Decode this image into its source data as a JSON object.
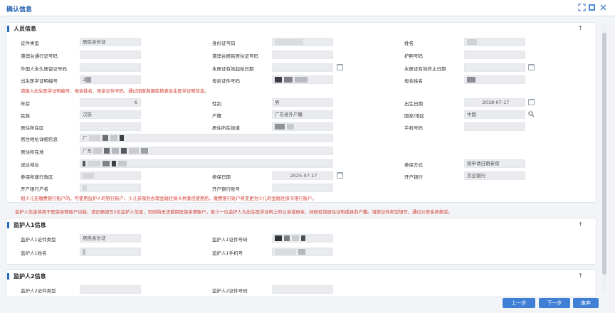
{
  "window": {
    "title": "确认信息"
  },
  "sections": {
    "person": "人员信息",
    "guardian1": "监护人1信息",
    "guardian2": "监护人2信息"
  },
  "person": {
    "id_type_label": "证件类型",
    "id_type_value": "居民身份证",
    "id_no_label": "身份证号码",
    "name_label": "姓名",
    "hk_permit_label": "港澳台通行证号码",
    "hk_residence_label": "港澳台居民居住证号码",
    "passport_label": "护照号码",
    "foreign_perm_label": "外国人永久居留证号码",
    "perm_start_label": "永居证有效起始日期",
    "perm_end_label": "永居证有效终止日期",
    "birth_cert_label": "出生医学证明编号",
    "birth_cert_value": "2",
    "mother_id_label": "母亲证件号码",
    "mother_name_label": "母亲姓名",
    "birth_warning": "请输入出生医学证明编号、母亲姓名、母亲证件号码，通过国家数据库核查出生医学证明信息。",
    "age_label": "年龄",
    "age_value": "6",
    "gender_label": "性别",
    "gender_value": "男",
    "birth_date_label": "出生日期",
    "birth_date_value": "2018-07-17",
    "ethnicity_label": "民族",
    "ethnicity_value": "汉族",
    "household_label": "户籍",
    "household_value": "广东省外户籍",
    "country_label": "国家/地区",
    "country_value": "中国",
    "residence_area_label": "居住所在区",
    "residence_street_label": "居住所在街道",
    "mobile_label": "手机号码",
    "residence_detail_label": "居住地址详细信息",
    "residence_detail_value": "广",
    "residence_place_label": "居住所在地",
    "residence_place_value": "广东",
    "mail_address_label": "送达地址",
    "insured_method_label": "参保方式",
    "insured_method_value": "按申请日期参保",
    "insured_area_label": "参保所属行政区",
    "insured_date_label": "参保日期",
    "insured_date_value": "2025-07-17",
    "bank_label": "开户银行",
    "bank_value": "农业银行",
    "account_name_label": "开户银行户名",
    "account_no_label": "开户银行账号",
    "bank_warning": "如少儿无缴费银行账户的，可使用监护人的银行账户；少儿参保后办理金融社保卡并激活使用后，缴费银行账户将变更为少儿的金融社保卡银行账户。"
  },
  "guardian_warning": "监护人信息将用于医保亲情账户功能，请正确填写2位监护人信息，否则将无法使用医保亲情账户。至少一位监护人为出生医学证明上的父亲或母亲，持既有效居住证明或具有户籍。请按证件类型填写，通过公安系统核验。",
  "guardian1": {
    "id_type_label": "监护人1证件类型",
    "id_type_value": "居民身份证",
    "id_no_label": "监护人1证件号码",
    "name_label": "监护人1姓名",
    "mobile_label": "监护人1手机号"
  },
  "guardian2": {
    "id_type_label": "监护人2证件类型",
    "id_no_label": "监护人2证件号码"
  },
  "buttons": {
    "prev": "上一步",
    "next": "下一步",
    "discard": "废弃"
  },
  "colors": {
    "accent": "#2a6bc4",
    "warning": "#d13a2f",
    "button": "#3f80d6"
  }
}
